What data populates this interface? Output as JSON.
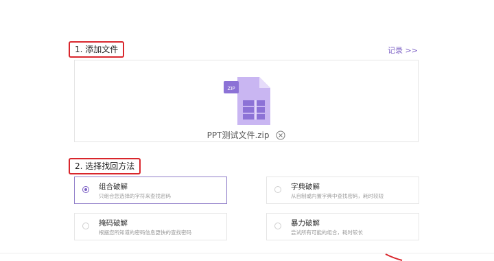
{
  "steps": {
    "add_file": "1. 添加文件",
    "choose_method": "2. 选择找回方法"
  },
  "records_link": "记录 >>",
  "upload": {
    "file_name": "PPT测试文件.zip",
    "file_icon": "zip-file-icon",
    "remove_icon": "remove-circle-icon"
  },
  "methods": [
    {
      "title": "组合破解",
      "desc": "只组合您选择的字符来查找密码",
      "selected": true
    },
    {
      "title": "字典破解",
      "desc": "从自制或内置字典中查找密码，耗时较短",
      "selected": false
    },
    {
      "title": "掩码破解",
      "desc": "根据您所知道的密码信息更快的查找密码",
      "selected": false
    },
    {
      "title": "暴力破解",
      "desc": "尝试所有可能的组合，耗时较长",
      "selected": false
    }
  ],
  "colors": {
    "accent": "#7b5fc4",
    "highlight_border": "#d9262c",
    "file_icon_light": "#c9b6f2",
    "file_icon_dark": "#8c72d6"
  }
}
